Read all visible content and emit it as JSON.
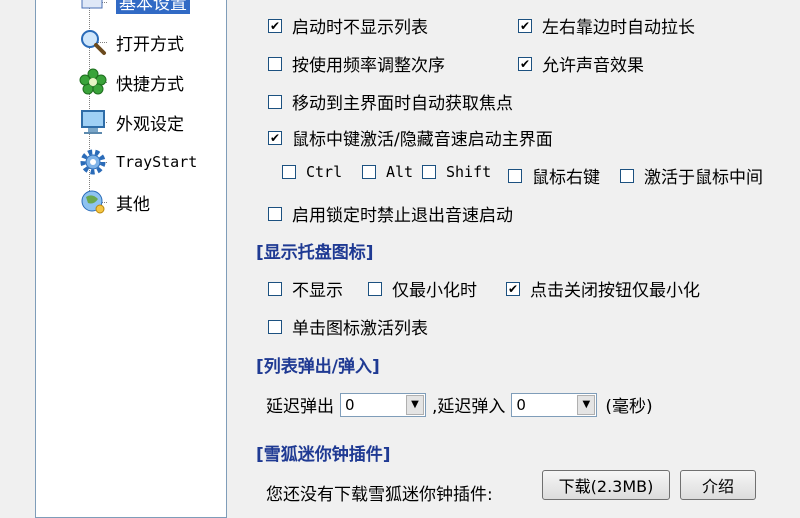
{
  "sidebar": {
    "items": [
      {
        "label": "基本设置",
        "icon": "document-icon"
      },
      {
        "label": "打开方式",
        "icon": "magnifier-icon"
      },
      {
        "label": "快捷方式",
        "icon": "flower-icon"
      },
      {
        "label": "外观设定",
        "icon": "monitor-icon"
      },
      {
        "label": "TrayStart",
        "icon": "gear-icon"
      },
      {
        "label": "其他",
        "icon": "globe-icon"
      }
    ]
  },
  "options": {
    "hide_list_on_start": {
      "label": "启动时不显示列表",
      "checked": true
    },
    "auto_extend_edge": {
      "label": "左右靠边时自动拉长",
      "checked": true
    },
    "sort_by_frequency": {
      "label": "按使用频率调整次序",
      "checked": false
    },
    "sound_effects": {
      "label": "允许声音效果",
      "checked": true
    },
    "auto_focus": {
      "label": "移动到主界面时自动获取焦点",
      "checked": false
    },
    "middle_click": {
      "label": "鼠标中键激活/隐藏音速启动主界面",
      "checked": true
    },
    "ctrl": {
      "label": "Ctrl",
      "checked": false
    },
    "alt": {
      "label": "Alt",
      "checked": false
    },
    "shift": {
      "label": "Shift",
      "checked": false
    },
    "right_button": {
      "label": "鼠标右键",
      "checked": false
    },
    "activate_middle": {
      "label": "激活于鼠标中间",
      "checked": false
    },
    "lock_no_exit": {
      "label": "启用锁定时禁止退出音速启动",
      "checked": false
    }
  },
  "tray": {
    "header": "[显示托盘图标]",
    "not_show": {
      "label": "不显示",
      "checked": false
    },
    "minimized_only": {
      "label": "仅最小化时",
      "checked": false
    },
    "close_minimize": {
      "label": "点击关闭按钮仅最小化",
      "checked": true
    },
    "click_activate": {
      "label": "单击图标激活列表",
      "checked": false
    }
  },
  "popup": {
    "header": "[列表弹出/弹入]",
    "delay_out_label": "延迟弹出",
    "delay_out_value": "0",
    "delay_in_label": ",延迟弹入",
    "delay_in_value": "0",
    "unit": "(毫秒)"
  },
  "plugin": {
    "header": "[雪狐迷你钟插件]",
    "message": "您还没有下载雪狐迷你钟插件:",
    "download_label": "下载(2.3MB)",
    "intro_label": "介绍"
  }
}
